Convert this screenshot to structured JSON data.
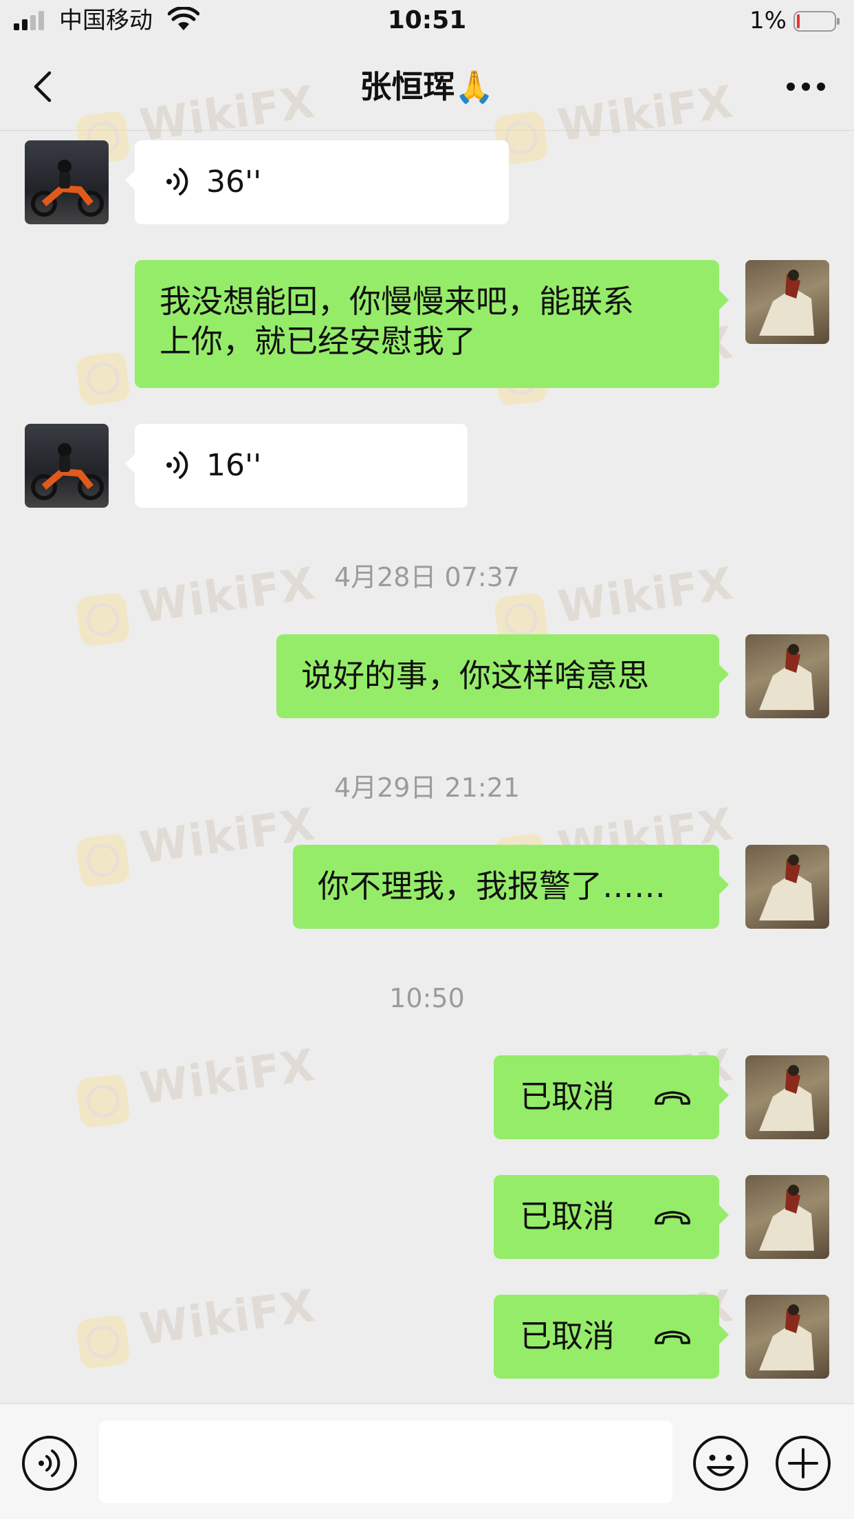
{
  "status_bar": {
    "carrier": "中国移动",
    "time": "10:51",
    "battery": "1%"
  },
  "header": {
    "title": "张恒珲🙏"
  },
  "watermark": "WikiFX",
  "messages": [
    {
      "type": "voice",
      "side": "left",
      "duration": "36''"
    },
    {
      "type": "text",
      "side": "right",
      "text_line1": "我没想能回，你慢慢来吧，能联系",
      "text_line2": "上你，就已经安慰我了"
    },
    {
      "type": "voice",
      "side": "left",
      "duration": "16''"
    },
    {
      "type": "timestamp",
      "text": "4月28日 07:37"
    },
    {
      "type": "text",
      "side": "right",
      "text": "说好的事，你这样啥意思"
    },
    {
      "type": "timestamp",
      "text": "4月29日 21:21"
    },
    {
      "type": "text",
      "side": "right",
      "text": "你不理我，我报警了……"
    },
    {
      "type": "timestamp",
      "text": "10:50"
    },
    {
      "type": "call",
      "side": "right",
      "text": "已取消"
    },
    {
      "type": "call",
      "side": "right",
      "text": "已取消"
    },
    {
      "type": "call",
      "side": "right",
      "text": "已取消"
    }
  ],
  "input_bar": {
    "placeholder": ""
  },
  "icons": [
    "back-icon",
    "more-icon",
    "voice-wave-icon",
    "phone-hangup-icon",
    "voice-input-icon",
    "emoji-icon",
    "plus-icon"
  ],
  "colors": {
    "background": "#ededed",
    "sent_bubble": "#95ec69",
    "received_bubble": "#ffffff",
    "timestamp": "#9b9b9b"
  }
}
